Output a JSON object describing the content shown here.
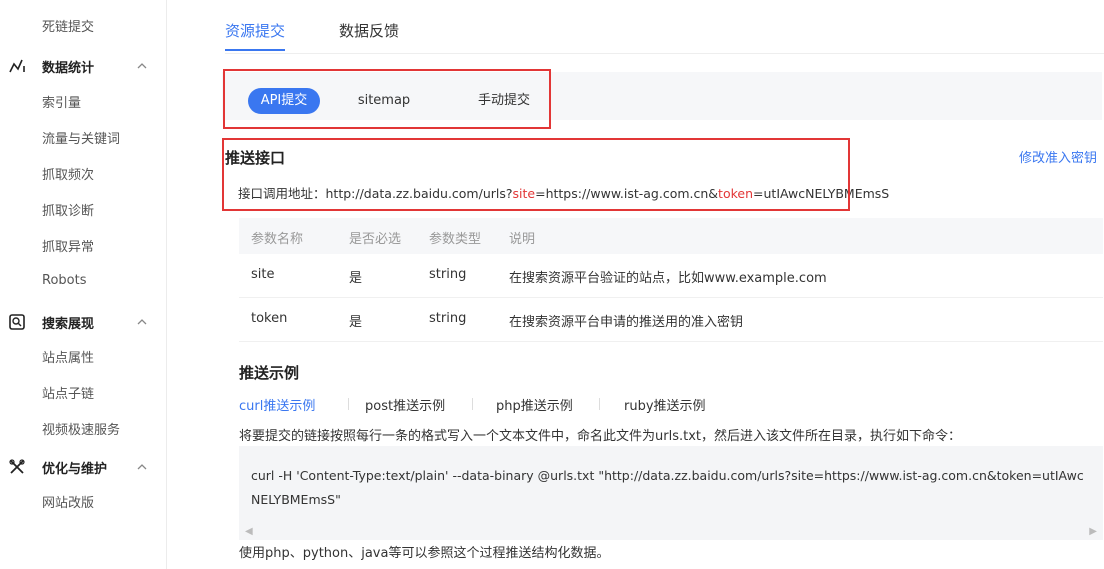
{
  "sidebar": {
    "top_item": "死链提交",
    "groups": [
      {
        "label": "数据统计",
        "items": [
          "索引量",
          "流量与关键词",
          "抓取频次",
          "抓取诊断",
          "抓取异常",
          "Robots"
        ]
      },
      {
        "label": "搜索展现",
        "items": [
          "站点属性",
          "站点子链",
          "视频极速服务"
        ]
      },
      {
        "label": "优化与维护",
        "items": [
          "网站改版"
        ]
      }
    ]
  },
  "tabs": [
    "资源提交",
    "数据反馈"
  ],
  "subtabs": [
    "API提交",
    "sitemap",
    "手动提交"
  ],
  "push_api": {
    "title": "推送接口",
    "modify_link": "修改准入密钥",
    "addr_prefix": "接口调用地址：http://data.zz.baidu.com/urls?",
    "site_key": "site",
    "site_value": "=https://www.ist-ag.com.cn&",
    "token_key": "token",
    "token_value": "=utIAwcNELYBMEmsS"
  },
  "param_table": {
    "headers": [
      "参数名称",
      "是否必选",
      "参数类型",
      "说明"
    ],
    "rows": [
      [
        "site",
        "是",
        "string",
        "在搜索资源平台验证的站点，比如www.example.com"
      ],
      [
        "token",
        "是",
        "string",
        "在搜索资源平台申请的推送用的准入密钥"
      ]
    ]
  },
  "example": {
    "title": "推送示例",
    "tabs": [
      "curl推送示例",
      "post推送示例",
      "php推送示例",
      "ruby推送示例"
    ],
    "instruction": "将要提交的链接按照每行一条的格式写入一个文本文件中，命名此文件为urls.txt，然后进入该文件所在目录，执行如下命令：",
    "code": "curl -H 'Content-Type:text/plain' --data-binary @urls.txt \"http://data.zz.baidu.com/urls?site=https://www.ist-ag.com.cn&token=utIAwcNELYBMEmsS\"",
    "footer": "使用php、python、java等可以参照这个过程推送结构化数据。"
  },
  "colors": {
    "accent": "#3a77f0",
    "highlight": "#e23636"
  }
}
